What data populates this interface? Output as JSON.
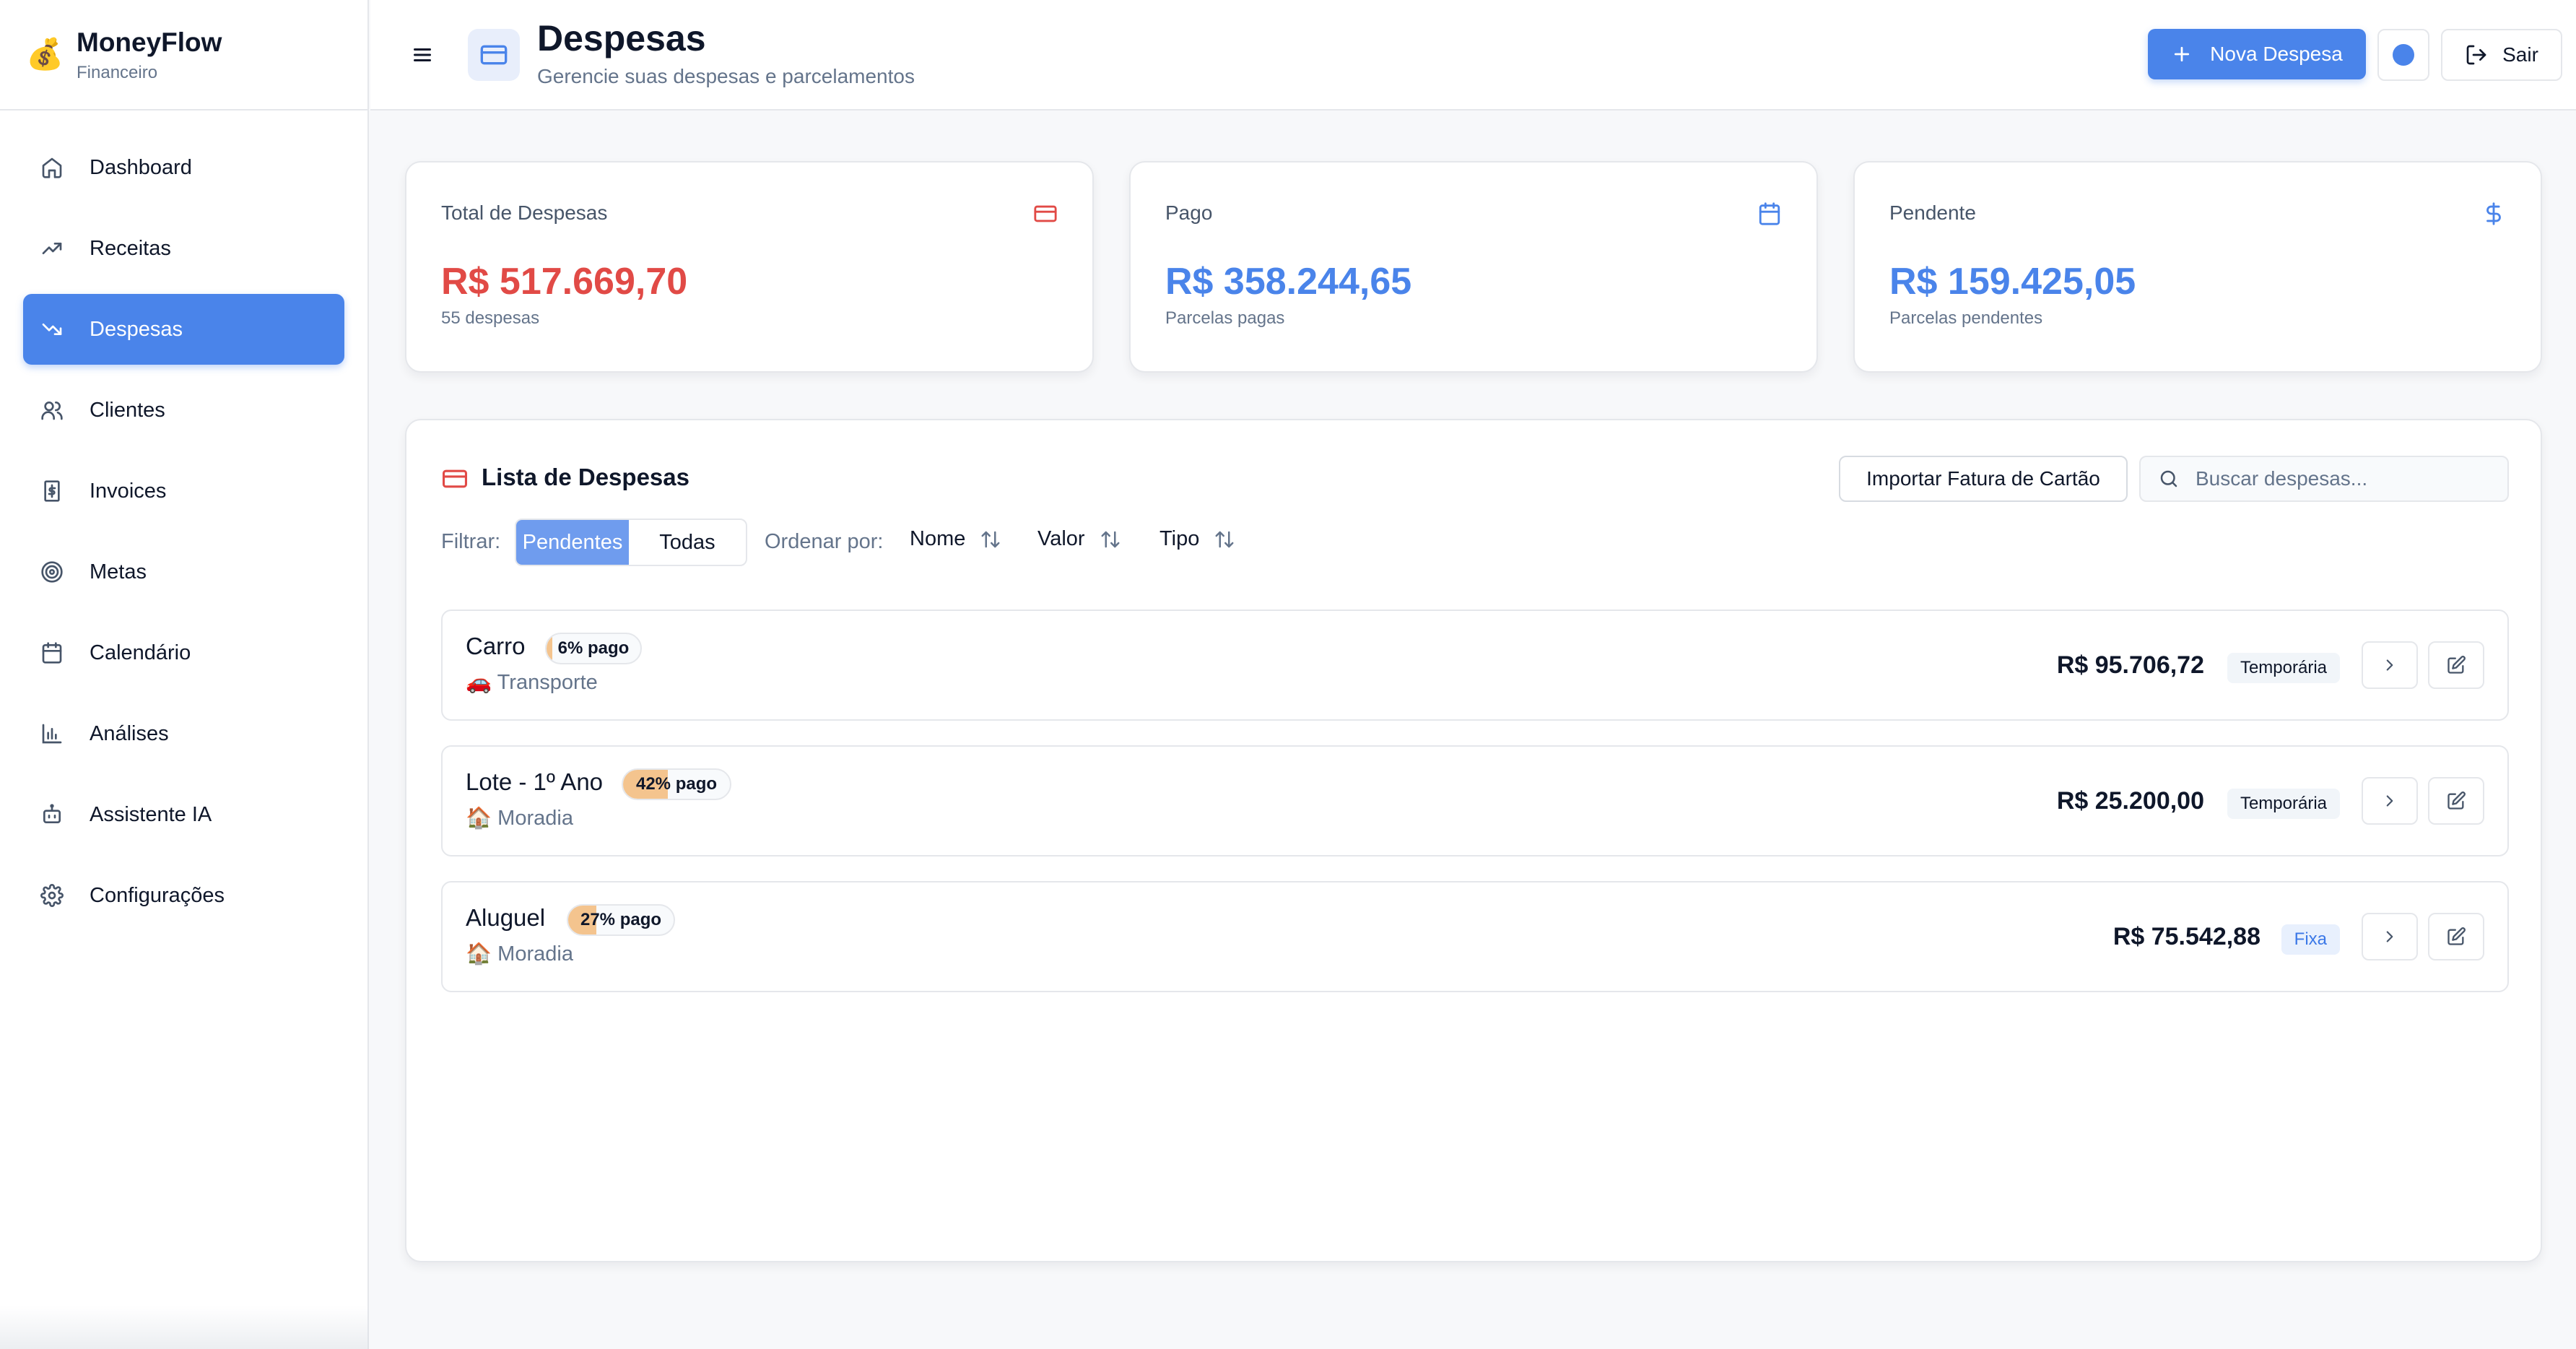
{
  "app": {
    "logo": "💰",
    "name": "MoneyFlow",
    "subtitle": "Financeiro"
  },
  "sidebar": {
    "items": [
      {
        "label": "Dashboard",
        "icon": "home-icon",
        "active": false
      },
      {
        "label": "Receitas",
        "icon": "trending-up-icon",
        "active": false
      },
      {
        "label": "Despesas",
        "icon": "trending-down-icon",
        "active": true
      },
      {
        "label": "Clientes",
        "icon": "users-icon",
        "active": false
      },
      {
        "label": "Invoices",
        "icon": "receipt-icon",
        "active": false
      },
      {
        "label": "Metas",
        "icon": "target-icon",
        "active": false
      },
      {
        "label": "Calendário",
        "icon": "calendar-icon",
        "active": false
      },
      {
        "label": "Análises",
        "icon": "bar-chart-icon",
        "active": false
      },
      {
        "label": "Assistente IA",
        "icon": "bot-icon",
        "active": false
      },
      {
        "label": "Configurações",
        "icon": "gear-icon",
        "active": false
      }
    ]
  },
  "header": {
    "title": "Despesas",
    "subtitle": "Gerencie suas despesas e parcelamentos",
    "new_button": "Nova Despesa",
    "logout_button": "Sair"
  },
  "stats": [
    {
      "label": "Total de Despesas",
      "value": "R$ 517.669,70",
      "note": "55 despesas",
      "color": "#e14a46",
      "icon": "credit-card-icon"
    },
    {
      "label": "Pago",
      "value": "R$ 358.244,65",
      "note": "Parcelas pagas",
      "color": "#4a84ea",
      "icon": "calendar-icon"
    },
    {
      "label": "Pendente",
      "value": "R$ 159.425,05",
      "note": "Parcelas pendentes",
      "color": "#4a84ea",
      "icon": "dollar-icon"
    }
  ],
  "list": {
    "title": "Lista de Despesas",
    "import_button": "Importar Fatura de Cartão",
    "search_placeholder": "Buscar despesas...",
    "filter_label": "Filtrar:",
    "filter_options": [
      "Pendentes",
      "Todas"
    ],
    "filter_selected": "Pendentes",
    "order_label": "Ordenar por:",
    "sort_options": [
      "Nome",
      "Valor",
      "Tipo"
    ],
    "items": [
      {
        "name": "Carro",
        "paid_pct": 6,
        "badge": "6% pago",
        "category_icon": "🚗",
        "category": "Transporte",
        "amount": "R$ 95.706,72",
        "type": "Temporária"
      },
      {
        "name": "Lote - 1º Ano",
        "paid_pct": 42,
        "badge": "42% pago",
        "category_icon": "🏠",
        "category": "Moradia",
        "amount": "R$ 25.200,00",
        "type": "Temporária"
      },
      {
        "name": "Aluguel",
        "paid_pct": 27,
        "badge": "27% pago",
        "category_icon": "🏠",
        "category": "Moradia",
        "amount": "R$ 75.542,88",
        "type": "Fixa"
      }
    ]
  }
}
